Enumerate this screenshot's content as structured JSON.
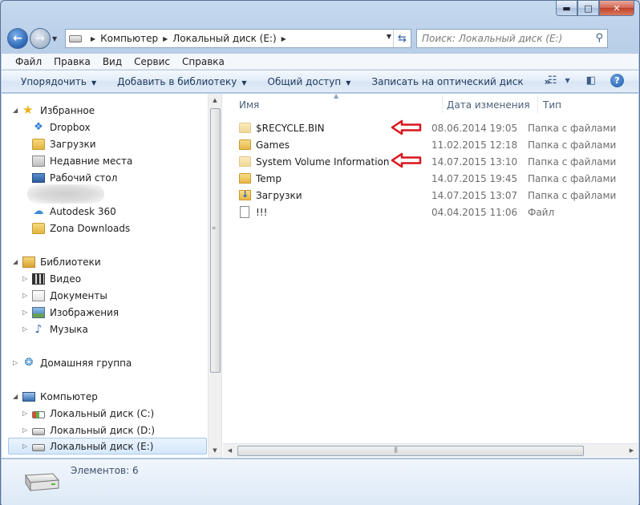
{
  "window": {
    "caption": {
      "minimize": "▬",
      "maximize": "□",
      "close": "✕"
    }
  },
  "address": {
    "crumbs": [
      "Компьютер",
      "Локальный диск (E:)"
    ],
    "search_placeholder": "Поиск: Локальный диск (E:)"
  },
  "menu": [
    "Файл",
    "Правка",
    "Вид",
    "Сервис",
    "Справка"
  ],
  "commands": {
    "organize": "Упорядочить",
    "add_to_library": "Добавить в библиотеку",
    "share": "Общий доступ",
    "burn": "Записать на оптический диск",
    "more": "»"
  },
  "nav": {
    "favorites": "Избранное",
    "dropbox": "Dropbox",
    "downloads": "Загрузки",
    "recent": "Недавние места",
    "desktop": "Рабочий стол",
    "autodesk": "Autodesk 360",
    "zona": "Zona Downloads",
    "libraries": "Библиотеки",
    "video": "Видео",
    "documents": "Документы",
    "images": "Изображения",
    "music": "Музыка",
    "homegroup": "Домашняя группа",
    "computer": "Компьютер",
    "disk_c": "Локальный диск (C:)",
    "disk_d": "Локальный диск (D:)",
    "disk_e": "Локальный диск (E:)"
  },
  "columns": {
    "name": "Имя",
    "date": "Дата изменения",
    "type": "Тип"
  },
  "files": [
    {
      "name": "$RECYCLE.BIN",
      "date": "08.06.2014 19:05",
      "type": "Папка с файлами"
    },
    {
      "name": "Games",
      "date": "11.02.2015 12:18",
      "type": "Папка с файлами"
    },
    {
      "name": "System Volume Information",
      "date": "14.07.2015 13:10",
      "type": "Папка с файлами"
    },
    {
      "name": "Temp",
      "date": "14.07.2015 19:45",
      "type": "Папка с файлами"
    },
    {
      "name": "Загрузки",
      "date": "14.07.2015 13:07",
      "type": "Папка с файлами"
    },
    {
      "name": "!!!",
      "date": "04.04.2015 11:06",
      "type": "Файл"
    }
  ],
  "status": {
    "count": "Элементов: 6"
  },
  "colors": {
    "annotation_arrow": "#d9151d",
    "selection": "#d5e8fb"
  }
}
